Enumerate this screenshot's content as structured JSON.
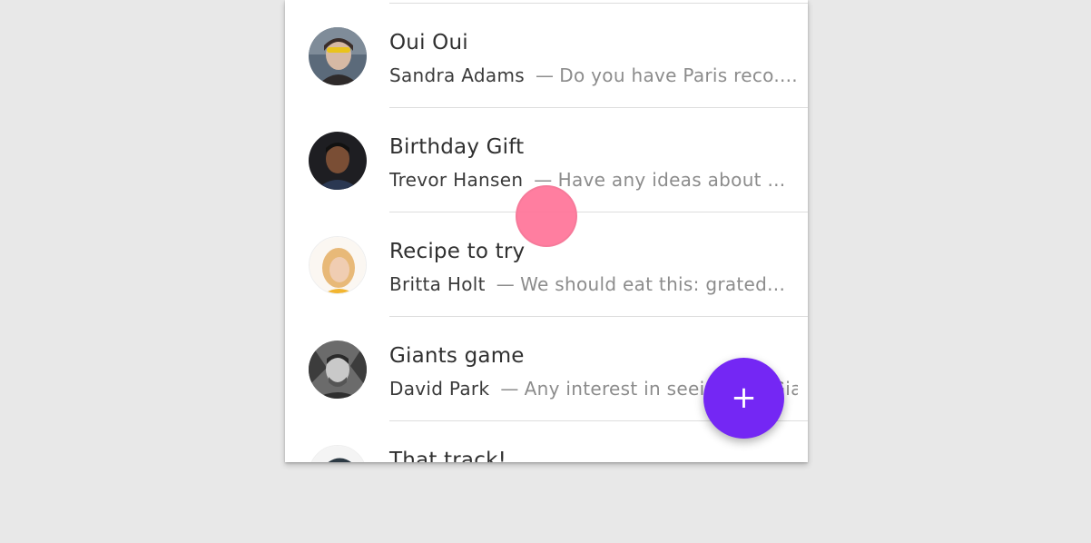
{
  "messages": [
    {
      "title": "Oui Oui",
      "sender": "Sandra Adams",
      "separator": "—",
      "snippet": "Do you have Paris reco...."
    },
    {
      "title": "Birthday Gift",
      "sender": "Trevor Hansen",
      "separator": "—",
      "snippet": "Have any ideas about ..."
    },
    {
      "title": "Recipe to try",
      "sender": "Britta Holt",
      "separator": "—",
      "snippet": "We should eat this: grated..."
    },
    {
      "title": "Giants game",
      "sender": "David Park",
      "separator": "—",
      "snippet": "Any interest in seeing the Giants..."
    },
    {
      "title": "That track!",
      "sender": "",
      "separator": "",
      "snippet": ""
    }
  ],
  "fab": {
    "icon": "plus-icon",
    "label": "+"
  },
  "colors": {
    "fab": "#7427f4",
    "touch_indicator": "#ff7096",
    "background": "#e8e8e8"
  }
}
